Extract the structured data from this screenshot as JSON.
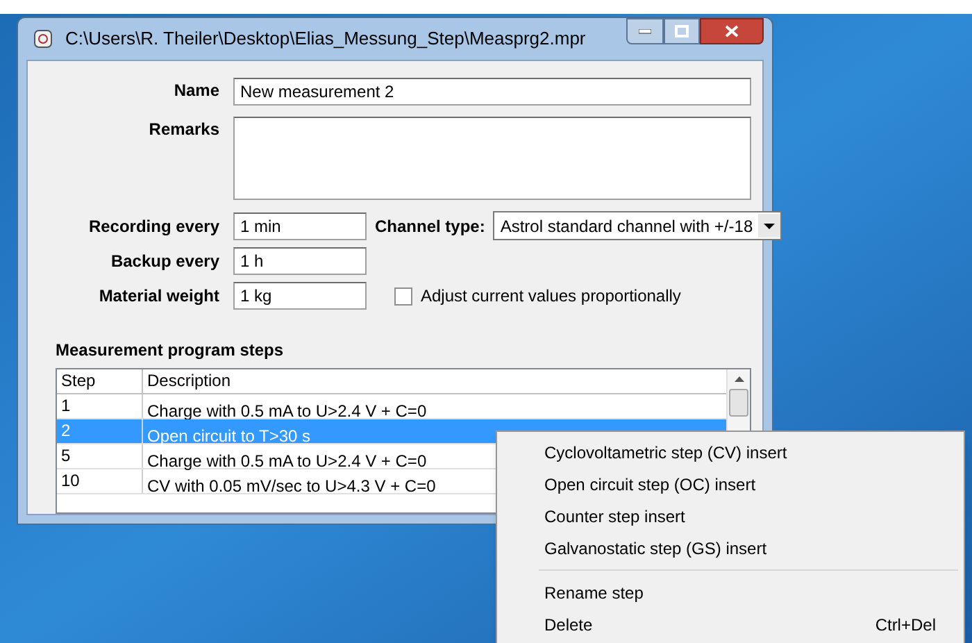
{
  "window": {
    "title": "C:\\Users\\R. Theiler\\Desktop\\Elias_Messung_Step\\Measprg2.mpr"
  },
  "form": {
    "name_label": "Name",
    "name_value": "New measurement 2",
    "remarks_label": "Remarks",
    "recording_label": "Recording every",
    "recording_value": "1 min",
    "channel_label": "Channel type:",
    "channel_value": "Astrol standard channel with +/-18",
    "backup_label": "Backup every",
    "backup_value": "1 h",
    "weight_label": "Material weight",
    "weight_value": "1 kg",
    "adjust_label": "Adjust current values proportionally",
    "adjust_checked": false
  },
  "steps": {
    "title": "Measurement program steps",
    "columns": [
      "Step",
      "Description"
    ],
    "rows": [
      {
        "step": "1",
        "description": "Charge with 0.5 mA to U>2.4 V + C=0",
        "selected": false
      },
      {
        "step": "2",
        "description": "Open circuit to T>30 s",
        "selected": true
      },
      {
        "step": "5",
        "description": "Charge with 0.5 mA to U>2.4 V + C=0",
        "selected": false
      },
      {
        "step": "10",
        "description": "CV with 0.05 mV/sec to U>4.3 V + C=0",
        "selected": false
      }
    ]
  },
  "context_menu": [
    {
      "kind": "item",
      "label": "Cyclovoltametric step (CV) insert"
    },
    {
      "kind": "item",
      "label": "Open circuit step (OC) insert"
    },
    {
      "kind": "item",
      "label": "Counter step insert"
    },
    {
      "kind": "item",
      "label": "Galvanostatic step (GS) insert"
    },
    {
      "kind": "separator"
    },
    {
      "kind": "item",
      "label": "Rename step"
    },
    {
      "kind": "item",
      "label": "Delete",
      "shortcut": "Ctrl+Del"
    }
  ]
}
